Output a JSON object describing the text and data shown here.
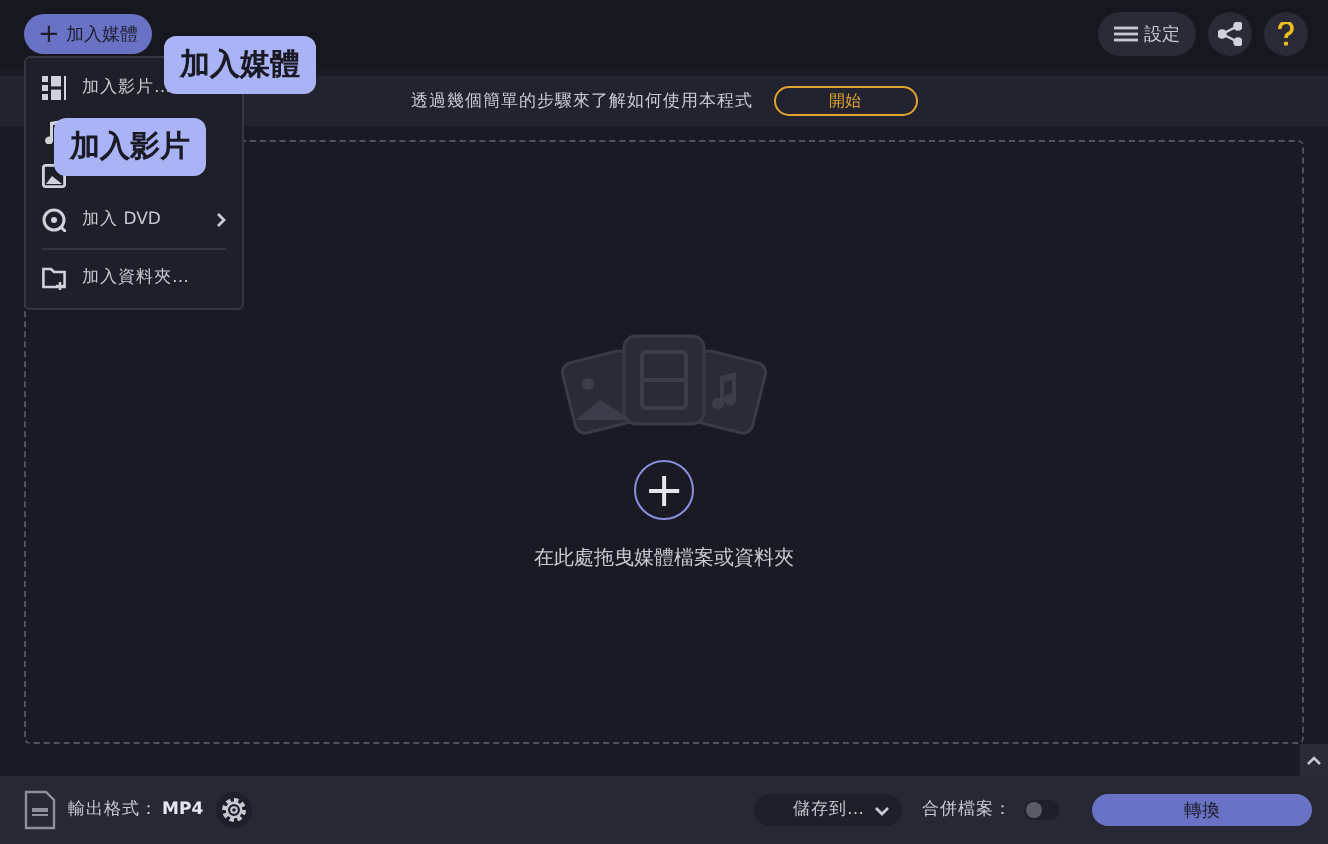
{
  "toolbar": {
    "add_media": {
      "icon": "+",
      "label": "加入媒體"
    },
    "settings": {
      "label": "設定"
    }
  },
  "banner": {
    "text": "透過幾個簡單的步驟來了解如何使用本程式",
    "button": "開始"
  },
  "menu": {
    "open": true,
    "items": [
      {
        "kind": "video",
        "label": "加入影片…"
      },
      {
        "kind": "audio"
      },
      {
        "kind": "image"
      },
      {
        "kind": "dvd",
        "label": "加入 DVD",
        "submenu": true
      },
      {
        "kind": "divider"
      },
      {
        "kind": "folder",
        "label": "加入資料夾…"
      }
    ]
  },
  "tooltips": [
    {
      "kind": "media",
      "text": "加入媒體"
    },
    {
      "kind": "video",
      "text": "加入影片"
    }
  ],
  "drop_zone": {
    "plus": "+",
    "hint": "在此處拖曳媒體檔案或資料夾"
  },
  "bottom_bar": {
    "format_label": "輸出格式：",
    "format": "MP4",
    "save_to": "儲存到…",
    "merge_label": "合併檔案：",
    "merge": {
      "on": false
    },
    "convert": "轉換"
  }
}
